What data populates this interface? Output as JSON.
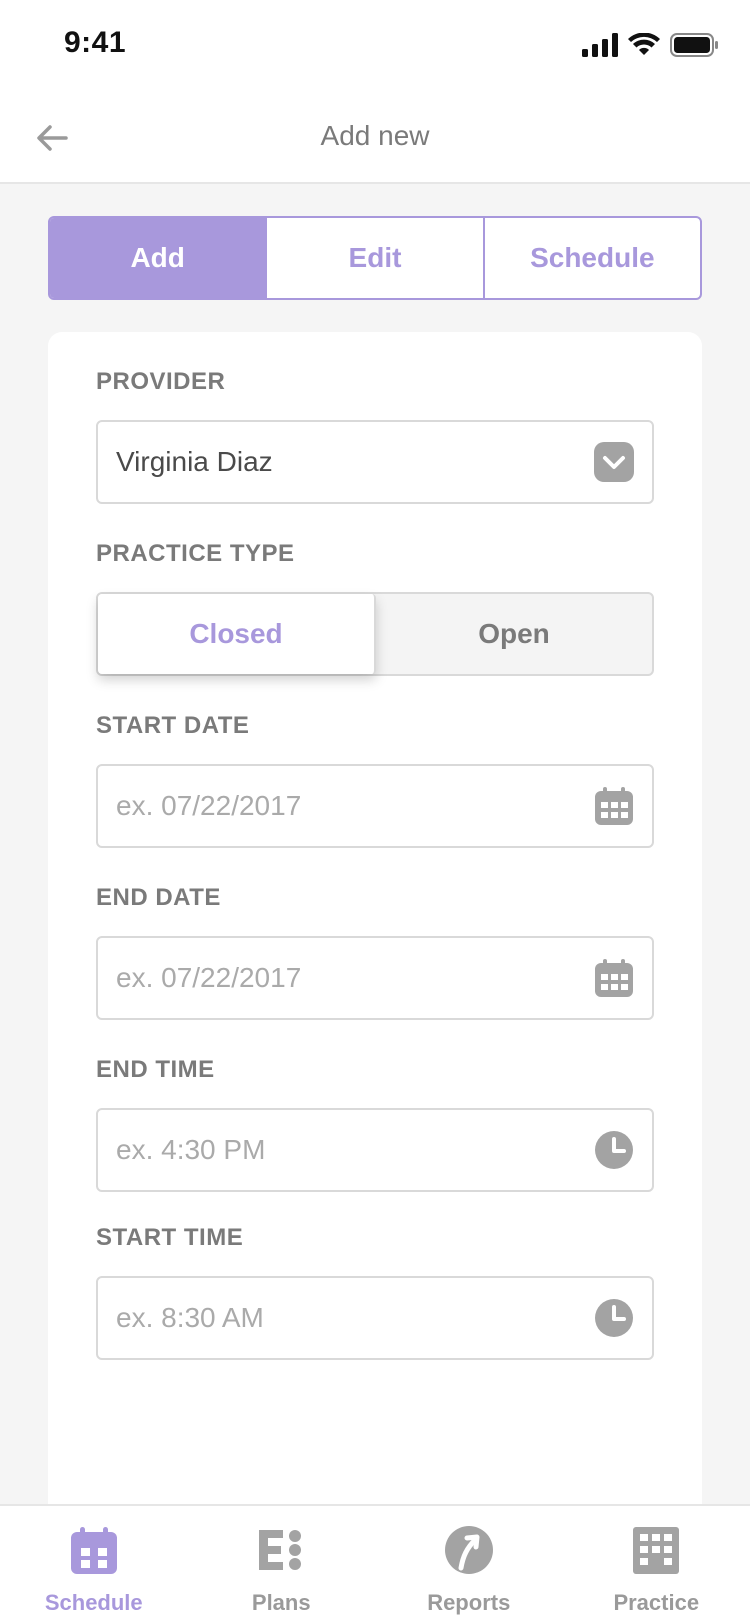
{
  "status_bar": {
    "time": "9:41"
  },
  "header": {
    "title": "Add new",
    "back_icon": "arrow-left-icon"
  },
  "segments": [
    {
      "label": "Add",
      "active": true
    },
    {
      "label": "Edit",
      "active": false
    },
    {
      "label": "Schedule",
      "active": false
    }
  ],
  "form": {
    "provider": {
      "label": "PROVIDER",
      "value": "Virginia Diaz",
      "icon": "chevron-down-icon"
    },
    "practice_type": {
      "label": "PRACTICE TYPE",
      "options": [
        "Closed",
        "Open"
      ],
      "selected": "Closed"
    },
    "start_date": {
      "label": "START DATE",
      "placeholder": "ex. 07/22/2017",
      "icon": "calendar-icon"
    },
    "end_date": {
      "label": "END DATE",
      "placeholder": "ex. 07/22/2017",
      "icon": "calendar-icon"
    },
    "end_time": {
      "label": "END TIME",
      "placeholder": "ex. 4:30 PM",
      "icon": "clock-icon"
    },
    "start_time": {
      "label": "START TIME",
      "placeholder": "ex. 8:30 AM",
      "icon": "clock-icon"
    }
  },
  "tab_bar": [
    {
      "label": "Schedule",
      "icon": "calendar-icon",
      "active": true
    },
    {
      "label": "Plans",
      "icon": "plans-icon",
      "active": false
    },
    {
      "label": "Reports",
      "icon": "reports-icon",
      "active": false
    },
    {
      "label": "Practice",
      "icon": "building-icon",
      "active": false
    }
  ],
  "colors": {
    "accent": "#a898dc",
    "text": "#7a7a7a",
    "border": "#d9d9d9",
    "background": "#f5f5f5"
  }
}
